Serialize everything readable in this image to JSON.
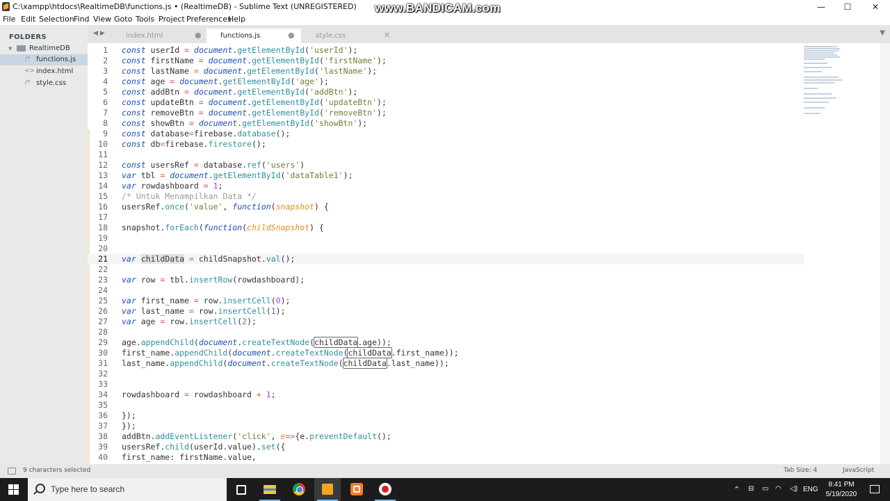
{
  "window": {
    "title": "C:\\xampp\\htdocs\\RealtimeDB\\functions.js • (RealtimeDB) - Sublime Text (UNREGISTERED)",
    "watermark": "www.BANDICAM.com",
    "controls": {
      "minimize": "—",
      "maximize": "☐",
      "close": "✕"
    }
  },
  "menu": [
    "File",
    "Edit",
    "Selection",
    "Find",
    "View",
    "Goto",
    "Tools",
    "Project",
    "Preferences",
    "Help"
  ],
  "sidebar": {
    "header": "FOLDERS",
    "folder": "RealtimeDB",
    "files": [
      {
        "name": "functions.js",
        "icon": "/*",
        "selected": true
      },
      {
        "name": "index.html",
        "icon": "<>",
        "selected": false
      },
      {
        "name": "style.css",
        "icon": "/*",
        "selected": false
      }
    ]
  },
  "tabs": [
    {
      "label": "index.html",
      "close": "●",
      "active": false
    },
    {
      "label": "functions.js",
      "close": "●",
      "active": true
    },
    {
      "label": "style.css",
      "close": "✕",
      "active": false
    }
  ],
  "editor": {
    "current_line": 21,
    "lines": [
      {
        "n": "1",
        "html": "<span class=\"kw\">const</span> userId <span class=\"op\">=</span> <span class=\"kw\">document</span>.<span class=\"fn\">getElementById</span>(<span class=\"st\">'userId'</span>);"
      },
      {
        "n": "2",
        "html": "<span class=\"kw\">const</span> firstName <span class=\"op\">=</span> <span class=\"kw\">document</span>.<span class=\"fn\">getElementById</span>(<span class=\"st\">'firstName'</span>);"
      },
      {
        "n": "3",
        "html": "<span class=\"kw\">const</span> lastName <span class=\"op\">=</span> <span class=\"kw\">document</span>.<span class=\"fn\">getElementById</span>(<span class=\"st\">'lastName'</span>);"
      },
      {
        "n": "4",
        "html": "<span class=\"kw\">const</span> age <span class=\"op\">=</span> <span class=\"kw\">document</span>.<span class=\"fn\">getElementById</span>(<span class=\"st\">'age'</span>);"
      },
      {
        "n": "5",
        "html": "<span class=\"kw\">const</span> addBtn <span class=\"op\">=</span> <span class=\"kw\">document</span>.<span class=\"fn\">getElementById</span>(<span class=\"st\">'addBtn'</span>);"
      },
      {
        "n": "6",
        "html": "<span class=\"kw\">const</span> updateBtn <span class=\"op\">=</span> <span class=\"kw\">document</span>.<span class=\"fn\">getElementById</span>(<span class=\"st\">'updateBtn'</span>);"
      },
      {
        "n": "7",
        "html": "<span class=\"kw\">const</span> removeBtn <span class=\"op\">=</span> <span class=\"kw\">document</span>.<span class=\"fn\">getElementById</span>(<span class=\"st\">'removeBtn'</span>);"
      },
      {
        "n": "8",
        "html": "<span class=\"kw\">const</span> showBtn <span class=\"op\">=</span> <span class=\"kw\">document</span>.<span class=\"fn\">getElementById</span>(<span class=\"st\">'showBtn'</span>);"
      },
      {
        "n": "9",
        "html": "<span class=\"kw\">const</span> database<span class=\"op\">=</span>firebase.<span class=\"fn\">database</span>();"
      },
      {
        "n": "10",
        "html": "<span class=\"kw\">const</span> db<span class=\"op\">=</span>firebase.<span class=\"fn\">firestore</span>();"
      },
      {
        "n": "11",
        "html": ""
      },
      {
        "n": "12",
        "html": "<span class=\"kw\">const</span> usersRef <span class=\"op\">=</span> database.<span class=\"fn\">ref</span>(<span class=\"st\">'users'</span>)"
      },
      {
        "n": "13",
        "html": "<span class=\"kw\">var</span> tbl <span class=\"op\">=</span> <span class=\"kw\">document</span>.<span class=\"fn\">getElementById</span>(<span class=\"st\">'dataTable1'</span>);"
      },
      {
        "n": "14",
        "html": "<span class=\"kw\">var</span> rowdashboard <span class=\"op\">=</span> <span class=\"nm\">1</span>;"
      },
      {
        "n": "15",
        "html": "<span class=\"cm\">/* Untuk Menampilkan Data */</span>"
      },
      {
        "n": "16",
        "html": "usersRef.<span class=\"fn\">once</span>(<span class=\"st\">'value'</span>, <span class=\"kw\">function</span>(<span class=\"pm\">snapshot</span>) {"
      },
      {
        "n": "17",
        "html": ""
      },
      {
        "n": "18",
        "html": "snapshot.<span class=\"fn\">forEach</span>(<span class=\"kw\">function</span>(<span class=\"pm\">childSnapshot</span>) {"
      },
      {
        "n": "19",
        "html": ""
      },
      {
        "n": "20",
        "html": ""
      },
      {
        "n": "21",
        "html": "<span class=\"kw\">var</span> <span class=\"hl\">childData</span> <span class=\"op\">=</span> childSnapshot.<span class=\"fn\">val</span>();"
      },
      {
        "n": "22",
        "html": ""
      },
      {
        "n": "23",
        "html": "<span class=\"kw\">var</span> row <span class=\"op\">=</span> tbl.<span class=\"fn\">insertRow</span>(rowdashboard);"
      },
      {
        "n": "24",
        "html": ""
      },
      {
        "n": "25",
        "html": "<span class=\"kw\">var</span> first_name <span class=\"op\">=</span> row.<span class=\"fn\">insertCell</span>(<span class=\"nm\">0</span>);"
      },
      {
        "n": "26",
        "html": "<span class=\"kw\">var</span> last_name <span class=\"op\">=</span> row.<span class=\"fn\">insertCell</span>(<span class=\"nm\">1</span>);"
      },
      {
        "n": "27",
        "html": "<span class=\"kw\">var</span> age <span class=\"op\">=</span> row.<span class=\"fn\">insertCell</span>(<span class=\"nm\">2</span>);"
      },
      {
        "n": "28",
        "html": ""
      },
      {
        "n": "29",
        "html": "age.<span class=\"fn\">appendChild</span>(<span class=\"kw\">document</span>.<span class=\"fn\">createTextNode</span>(<span class=\"mk\">childData</span>.age));"
      },
      {
        "n": "30",
        "html": "first_name.<span class=\"fn\">appendChild</span>(<span class=\"kw\">document</span>.<span class=\"fn\">createTextNode</span>(<span class=\"mk\">childData</span>.first_name));"
      },
      {
        "n": "31",
        "html": "last_name.<span class=\"fn\">appendChild</span>(<span class=\"kw\">document</span>.<span class=\"fn\">createTextNode</span>(<span class=\"mk\">childData</span>.last_name));"
      },
      {
        "n": "32",
        "html": ""
      },
      {
        "n": "33",
        "html": ""
      },
      {
        "n": "34",
        "html": "rowdashboard <span class=\"op\">=</span> rowdashboard <span class=\"op\">+</span> <span class=\"nm\">1</span>;"
      },
      {
        "n": "35",
        "html": ""
      },
      {
        "n": "36",
        "html": "});"
      },
      {
        "n": "37",
        "html": "});"
      },
      {
        "n": "38",
        "html": "addBtn.<span class=\"fn\">addEventListener</span>(<span class=\"st\">'click'</span>, <span class=\"pm\">e</span><span class=\"op\">=&gt;</span>{e.<span class=\"fn\">preventDefault</span>();"
      },
      {
        "n": "39",
        "html": "usersRef.<span class=\"fn\">child</span>(userId.value).<span class=\"fn\">set</span>({"
      },
      {
        "n": "40",
        "html": "first_name: firstName.value,"
      }
    ]
  },
  "status": {
    "left": "9 characters selected",
    "tab_size": "Tab Size: 4",
    "syntax": "JavaScript"
  },
  "taskbar": {
    "search_placeholder": "Type here to search",
    "language": "ENG",
    "time": "8:41 PM",
    "date": "5/19/2020"
  }
}
